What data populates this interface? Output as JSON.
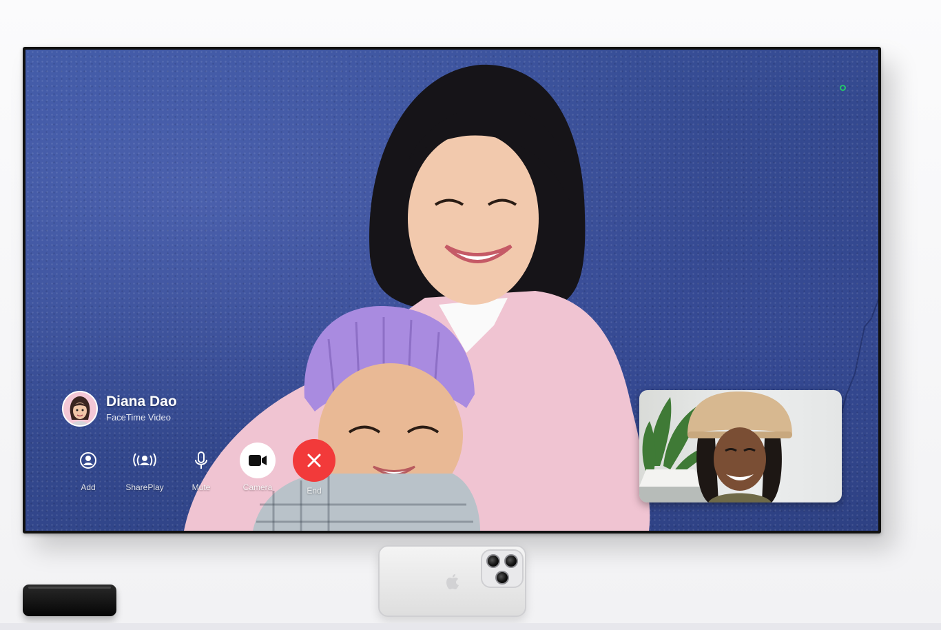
{
  "call": {
    "caller_name": "Diana Dao",
    "caller_subtitle": "FaceTime Video"
  },
  "controls": [
    {
      "label": "Add",
      "icon": "add-person-icon"
    },
    {
      "label": "SharePlay",
      "icon": "shareplay-icon"
    },
    {
      "label": "Mute",
      "icon": "microphone-icon"
    },
    {
      "label": "Camera",
      "icon": "video-camera-icon"
    },
    {
      "label": "End",
      "icon": "close-icon"
    }
  ],
  "colors": {
    "end_call": "#f23a3a",
    "camera_indicator": "#23c66a",
    "wall": "#34498f"
  }
}
